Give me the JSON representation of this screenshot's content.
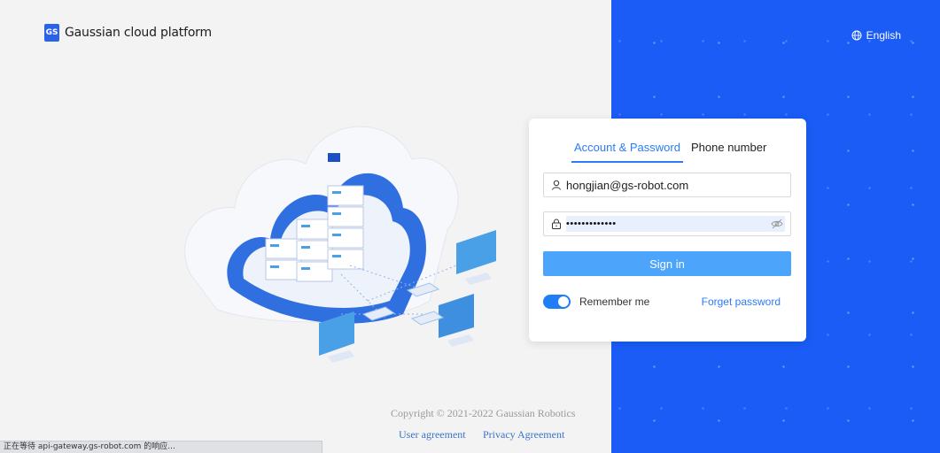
{
  "brand": {
    "logo_text": "GS",
    "name": "Gaussian cloud platform"
  },
  "language": {
    "icon": "globe-icon",
    "label": "English"
  },
  "login": {
    "tabs": [
      {
        "label": "Account & Password",
        "active": true
      },
      {
        "label": "Phone number",
        "active": false
      }
    ],
    "username": {
      "icon": "user-icon",
      "value": "hongjian@gs-robot.com"
    },
    "password": {
      "icon": "lock-icon",
      "value": "•••••••••••••",
      "toggle_icon": "eye-off-icon"
    },
    "signin_label": "Sign in",
    "remember": {
      "label": "Remember me",
      "checked": true
    },
    "forgot_label": "Forget password"
  },
  "footer": {
    "copyright": "Copyright © 2021-2022 Gaussian Robotics",
    "user_agreement": "User agreement",
    "privacy_agreement": "Privacy Agreement"
  },
  "status_bar": "正在等待 api-gateway.gs-robot.com 的响应...",
  "colors": {
    "primary": "#2b7cf6",
    "panel": "#1a5cf5",
    "button": "#4da5fb"
  }
}
